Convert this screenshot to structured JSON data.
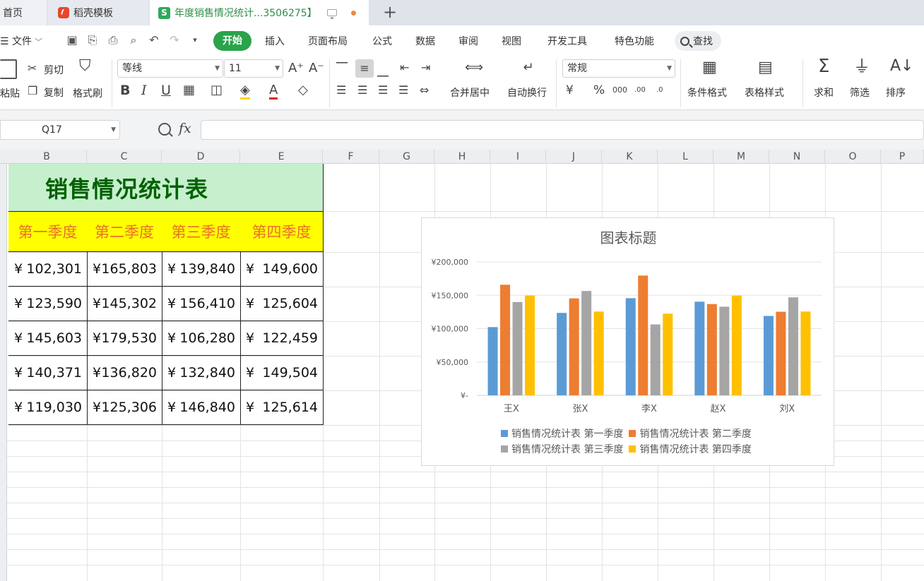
{
  "tabs": {
    "home": "首页",
    "template": "稻壳模板",
    "document": "年度销售情况统计...3506275】"
  },
  "menu": {
    "file": "文件",
    "tabs": [
      "开始",
      "插入",
      "页面布局",
      "公式",
      "数据",
      "审阅",
      "视图",
      "开发工具",
      "特色功能"
    ],
    "search": "查找"
  },
  "ribbon": {
    "paste": "粘贴",
    "cut": "剪切",
    "copy": "复制",
    "format_painter": "格式刷",
    "font_name": "等线",
    "font_size": "11",
    "merge_center": "合并居中",
    "wrap_text": "自动换行",
    "number_format": "常规",
    "conditional_format": "条件格式",
    "table_style": "表格样式",
    "sum": "求和",
    "filter": "筛选",
    "sort": "排序"
  },
  "formula_bar": {
    "cell_ref": "Q17",
    "fx": "fx",
    "formula": ""
  },
  "columns": [
    "B",
    "C",
    "D",
    "E",
    "F",
    "G",
    "H",
    "I",
    "J",
    "K",
    "L",
    "M",
    "N",
    "O",
    "P"
  ],
  "sheet": {
    "title": "销售情况统计表",
    "headers": [
      "第一季度",
      "第二季度",
      "第三季度",
      "第四季度"
    ],
    "currency": "¥",
    "rows": [
      [
        "102,301",
        "165,803",
        "139,840",
        "149,600"
      ],
      [
        "123,590",
        "145,302",
        "156,410",
        "125,604"
      ],
      [
        "145,603",
        "179,530",
        "106,280",
        "122,459"
      ],
      [
        "140,371",
        "136,820",
        "132,840",
        "149,504"
      ],
      [
        "119,030",
        "125,306",
        "146,840",
        "125,614"
      ]
    ]
  },
  "chart_data": {
    "type": "bar",
    "title": "图表标题",
    "categories": [
      "王X",
      "张X",
      "李X",
      "赵X",
      "刘X"
    ],
    "y_ticks": [
      "¥-",
      "¥50,000",
      "¥100,000",
      "¥150,000",
      "¥200,000"
    ],
    "ylim": [
      0,
      200000
    ],
    "legend_position": "bottom",
    "colors": [
      "#5b9bd5",
      "#ed7d31",
      "#a5a5a5",
      "#ffc000"
    ],
    "series": [
      {
        "name": "销售情况统计表 第一季度",
        "values": [
          102301,
          123590,
          145603,
          140371,
          119030
        ]
      },
      {
        "name": "销售情况统计表 第二季度",
        "values": [
          165803,
          145302,
          179530,
          136820,
          125306
        ]
      },
      {
        "name": "销售情况统计表 第三季度",
        "values": [
          139840,
          156410,
          106280,
          132840,
          146840
        ]
      },
      {
        "name": "销售情况统计表 第四季度",
        "values": [
          149600,
          125604,
          122459,
          149504,
          125614
        ]
      }
    ]
  }
}
